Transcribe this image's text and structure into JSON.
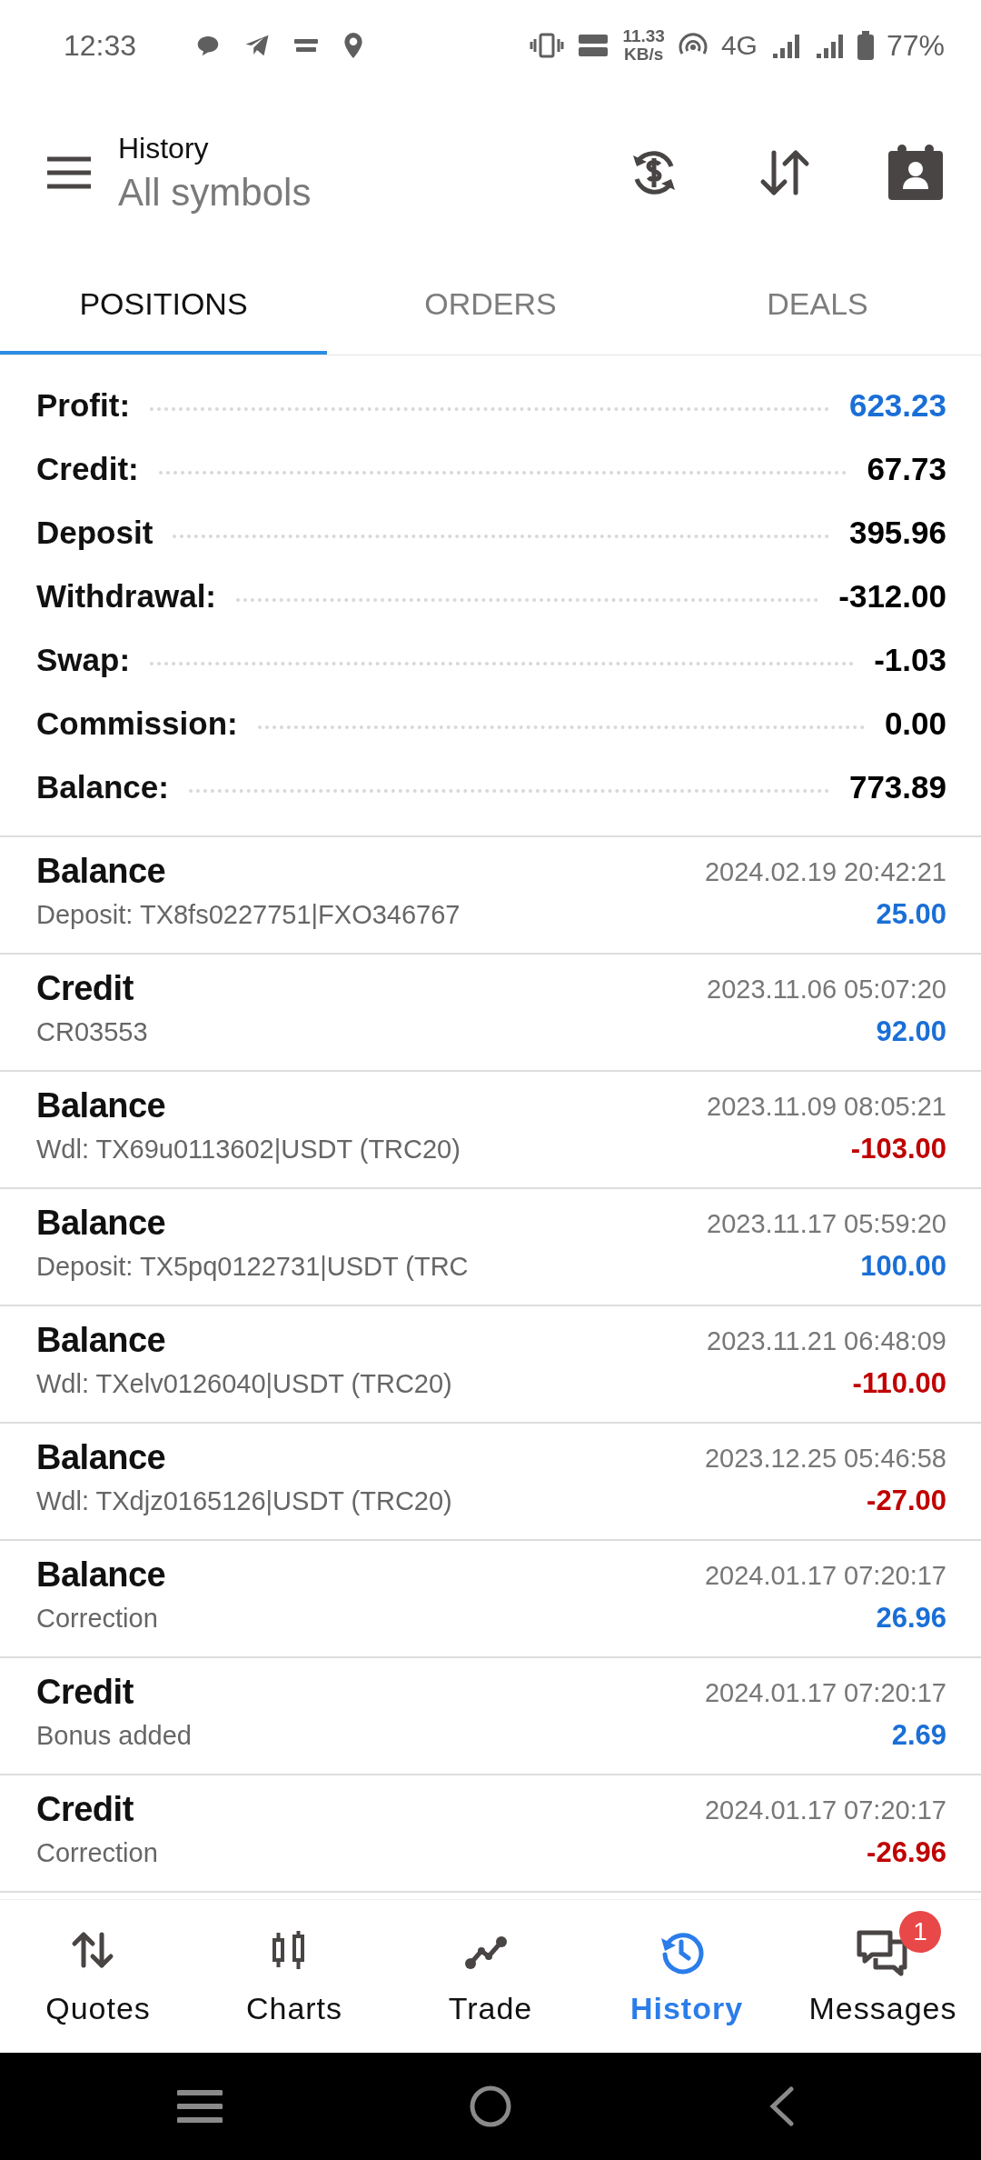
{
  "status_bar": {
    "time": "12:33",
    "speed_value": "11.33",
    "speed_unit": "KB/s",
    "network": "4G",
    "battery": "77%"
  },
  "header": {
    "title": "History",
    "subtitle": "All symbols"
  },
  "tabs": [
    {
      "label": "POSITIONS",
      "selected": true
    },
    {
      "label": "ORDERS",
      "selected": false
    },
    {
      "label": "DEALS",
      "selected": false
    }
  ],
  "summary": [
    {
      "label": "Profit:",
      "value": "623.23",
      "color": "#1a6fd6"
    },
    {
      "label": "Credit:",
      "value": "67.73",
      "color": "#000000"
    },
    {
      "label": "Deposit",
      "value": "395.96",
      "color": "#000000"
    },
    {
      "label": "Withdrawal:",
      "value": "-312.00",
      "color": "#000000"
    },
    {
      "label": "Swap:",
      "value": "-1.03",
      "color": "#000000"
    },
    {
      "label": "Commission:",
      "value": "0.00",
      "color": "#000000"
    },
    {
      "label": "Balance:",
      "value": "773.89",
      "color": "#000000"
    }
  ],
  "deals": [
    {
      "type": "Balance",
      "comment": "Deposit: TX8fs0227751|FXO346767",
      "time": "2024.02.19 20:42:21",
      "amount": "25.00",
      "color": "#1a6fd6"
    },
    {
      "type": "Credit",
      "comment": "CR03553",
      "time": "2023.11.06 05:07:20",
      "amount": "92.00",
      "color": "#1a6fd6"
    },
    {
      "type": "Balance",
      "comment": "Wdl: TX69u0113602|USDT (TRC20)",
      "time": "2023.11.09 08:05:21",
      "amount": "-103.00",
      "color": "#c00000"
    },
    {
      "type": "Balance",
      "comment": "Deposit: TX5pq0122731|USDT (TRC",
      "time": "2023.11.17 05:59:20",
      "amount": "100.00",
      "color": "#1a6fd6"
    },
    {
      "type": "Balance",
      "comment": "Wdl: TXelv0126040|USDT (TRC20)",
      "time": "2023.11.21 06:48:09",
      "amount": "-110.00",
      "color": "#c00000"
    },
    {
      "type": "Balance",
      "comment": "Wdl: TXdjz0165126|USDT (TRC20)",
      "time": "2023.12.25 05:46:58",
      "amount": "-27.00",
      "color": "#c00000"
    },
    {
      "type": "Balance",
      "comment": "Correction",
      "time": "2024.01.17 07:20:17",
      "amount": "26.96",
      "color": "#1a6fd6"
    },
    {
      "type": "Credit",
      "comment": "Bonus added",
      "time": "2024.01.17 07:20:17",
      "amount": "2.69",
      "color": "#1a6fd6"
    },
    {
      "type": "Credit",
      "comment": "Correction",
      "time": "2024.01.17 07:20:17",
      "amount": "-26.96",
      "color": "#c00000"
    }
  ],
  "bottom_nav": [
    {
      "label": "Quotes",
      "selected": false,
      "kind": "quotes"
    },
    {
      "label": "Charts",
      "selected": false,
      "kind": "charts"
    },
    {
      "label": "Trade",
      "selected": false,
      "kind": "trade"
    },
    {
      "label": "History",
      "selected": true,
      "kind": "history"
    },
    {
      "label": "Messages",
      "selected": false,
      "kind": "messages",
      "badge": "1"
    }
  ]
}
